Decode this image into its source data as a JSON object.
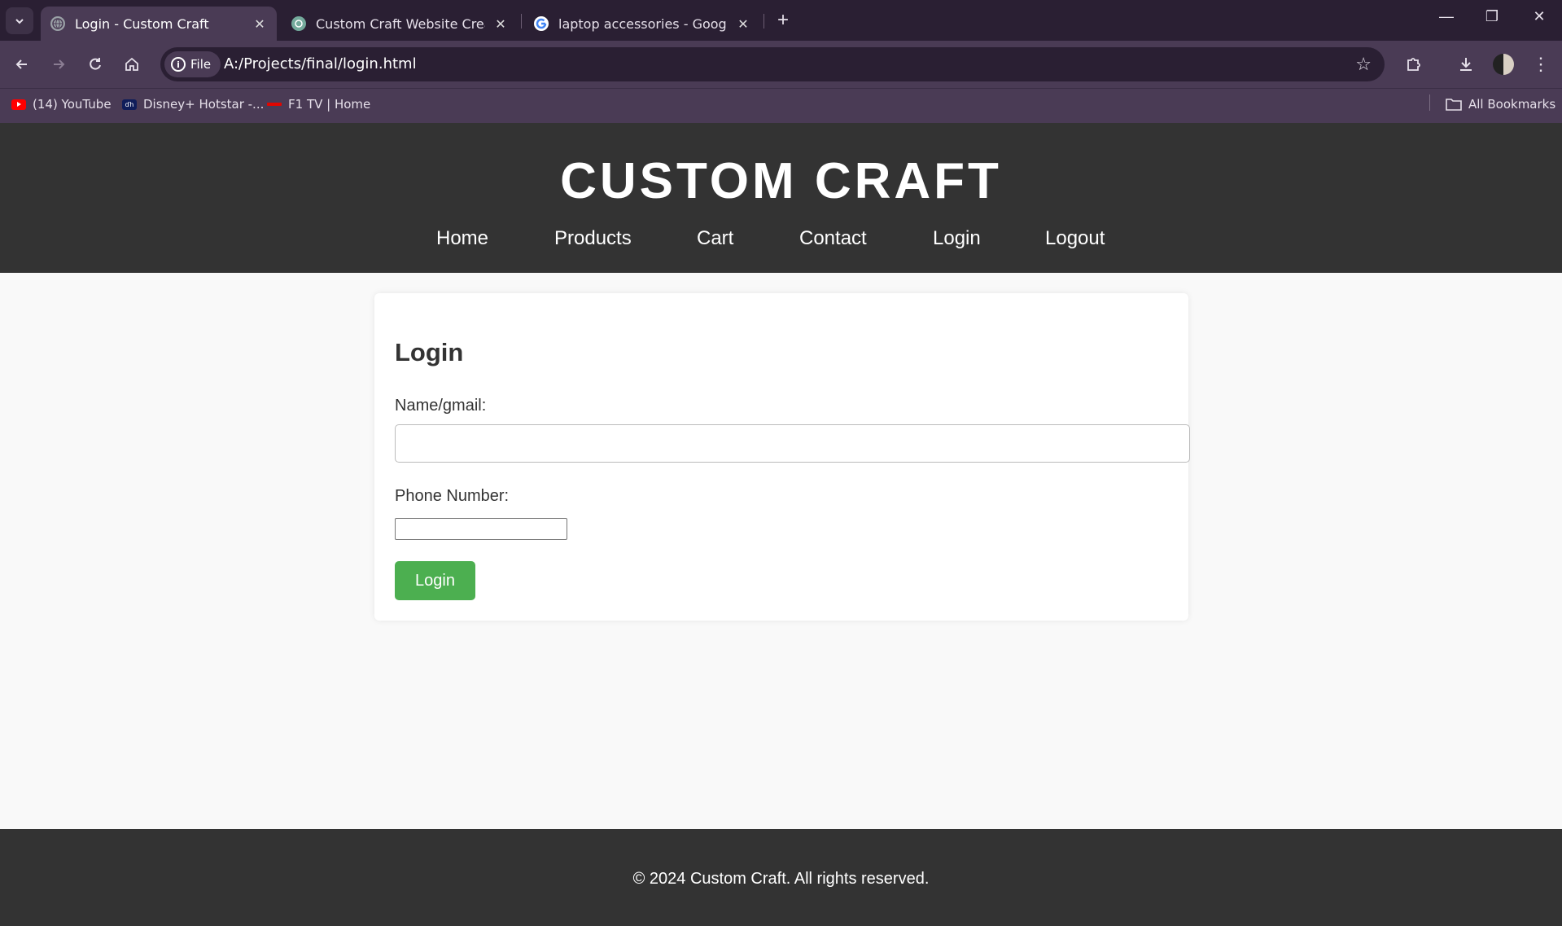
{
  "browser": {
    "tabs": [
      {
        "title": "Login - Custom Craft",
        "active": true
      },
      {
        "title": "Custom Craft Website Creation",
        "active": false
      },
      {
        "title": "laptop accessories - Google Sea",
        "active": false
      }
    ],
    "address": {
      "scheme_chip": "File",
      "url": "A:/Projects/final/login.html"
    },
    "bookmarks": [
      {
        "label": "(14) YouTube",
        "icon": "youtube-icon"
      },
      {
        "label": "Disney+ Hotstar -...",
        "icon": "hotstar-icon"
      },
      {
        "label": "F1 TV | Home",
        "icon": "f1-icon"
      }
    ],
    "all_bookmarks": "All Bookmarks"
  },
  "site": {
    "brand": "CUSTOM CRAFT",
    "nav": [
      "Home",
      "Products",
      "Cart",
      "Contact",
      "Login",
      "Logout"
    ],
    "form": {
      "heading": "Login",
      "name_label": "Name/gmail:",
      "phone_label": "Phone Number:",
      "submit": "Login"
    },
    "footer": "© 2024 Custom Craft. All rights reserved."
  },
  "colors": {
    "header_bg": "#333333",
    "button_green": "#4caf50",
    "browser_frame": "#2a1f33",
    "browser_toolbar": "#4a3b55"
  }
}
